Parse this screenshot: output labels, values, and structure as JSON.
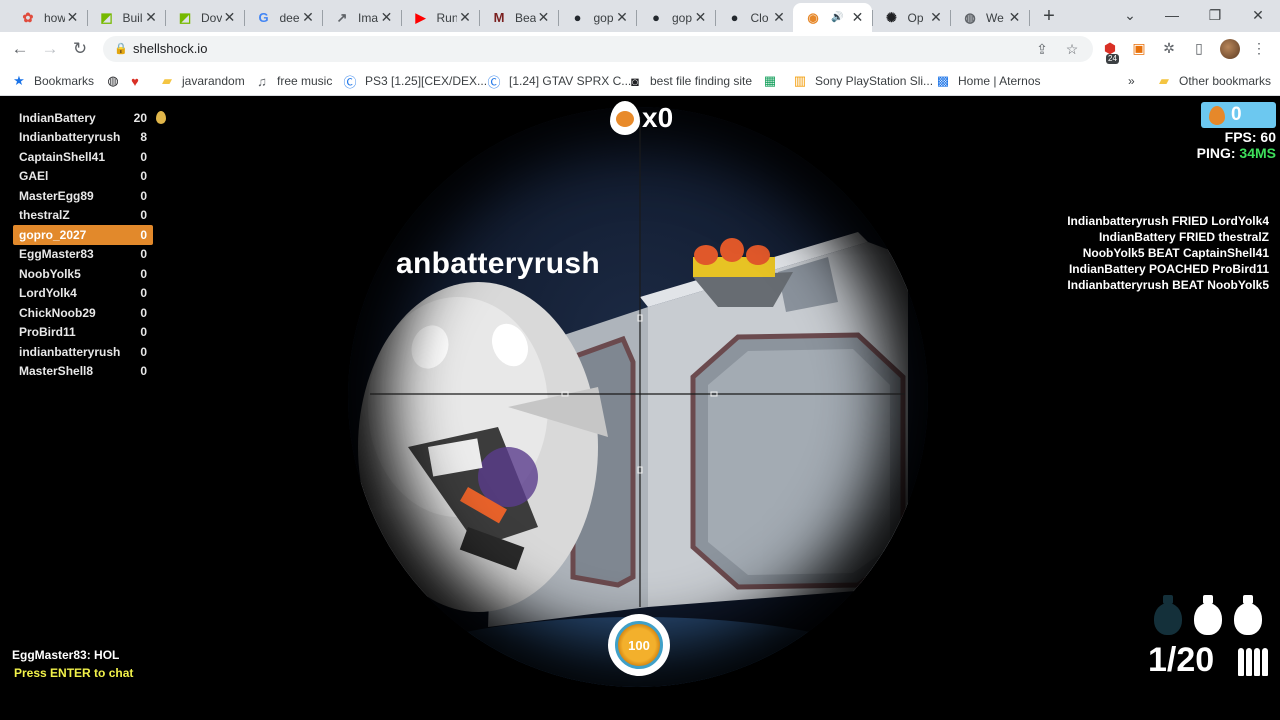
{
  "browser": {
    "tabs": [
      {
        "label": "how",
        "icon": "apps-icon",
        "color": "#e04b3d"
      },
      {
        "label": "Buil",
        "icon": "nvidia-icon",
        "color": "#76b900"
      },
      {
        "label": "Dov",
        "icon": "nvidia-icon",
        "color": "#76b900"
      },
      {
        "label": "dee",
        "icon": "google-icon",
        "color": "#4285f4"
      },
      {
        "label": "Ima",
        "icon": "trend-icon",
        "color": "#5f6368"
      },
      {
        "label": "Run",
        "icon": "youtube-icon",
        "color": "#ff0000"
      },
      {
        "label": "Bea",
        "icon": "m-icon",
        "color": "#7a1f1f"
      },
      {
        "label": "gop",
        "icon": "github-icon",
        "color": "#24292f"
      },
      {
        "label": "gop",
        "icon": "github-icon",
        "color": "#24292f"
      },
      {
        "label": "Clo",
        "icon": "github-icon",
        "color": "#24292f"
      },
      {
        "label": "",
        "icon": "shellshock-icon",
        "color": "#e6882a"
      },
      {
        "label": "Op",
        "icon": "openai-icon",
        "color": "#202124"
      },
      {
        "label": "We",
        "icon": "globe-icon",
        "color": "#5f6368"
      }
    ],
    "url": "shellshock.io",
    "extension_badge": "24"
  },
  "bookmarks": [
    {
      "label": "Bookmarks",
      "icon": "star-icon"
    },
    {
      "label": "",
      "icon": "globe-icon"
    },
    {
      "label": "",
      "icon": "heart-icon"
    },
    {
      "label": "javarandom",
      "icon": "folder-icon"
    },
    {
      "label": "free music",
      "icon": "music-icon"
    },
    {
      "label": "PS3 [1.25][CEX/DEX...",
      "icon": "c-icon"
    },
    {
      "label": "[1.24] GTAV SPRX C...",
      "icon": "c-icon"
    },
    {
      "label": "best file finding site",
      "icon": "robot-icon"
    },
    {
      "label": "",
      "icon": "sheet-icon"
    },
    {
      "label": "Sony PlayStation Sli...",
      "icon": "ps-icon"
    },
    {
      "label": "Home | Aternos",
      "icon": "aternos-icon"
    },
    {
      "label": "Other bookmarks",
      "icon": "folder-icon"
    }
  ],
  "game": {
    "player_name": "anbatteryrush",
    "killstreak": "x0",
    "eggs": "0",
    "fps_label": "FPS:",
    "fps_value": "60",
    "ping_label": "PING:",
    "ping_value": "34MS",
    "leaderboard": [
      {
        "name": "IndianBattery",
        "score": "20"
      },
      {
        "name": "Indianbatteryrush",
        "score": "8"
      },
      {
        "name": "CaptainShell41",
        "score": "0"
      },
      {
        "name": "GAEl",
        "score": "0"
      },
      {
        "name": "MasterEgg89",
        "score": "0"
      },
      {
        "name": "thestralZ",
        "score": "0"
      },
      {
        "name": "gopro_2027",
        "score": "0",
        "me": true
      },
      {
        "name": "EggMaster83",
        "score": "0"
      },
      {
        "name": "NoobYolk5",
        "score": "0"
      },
      {
        "name": "LordYolk4",
        "score": "0"
      },
      {
        "name": "ChickNoob29",
        "score": "0"
      },
      {
        "name": "ProBird11",
        "score": "0"
      },
      {
        "name": "indianbatteryrush",
        "score": "0"
      },
      {
        "name": "MasterShell8",
        "score": "0"
      }
    ],
    "killfeed": [
      "Indianbatteryrush FRIED LordYolk4",
      "IndianBattery FRIED thestralZ",
      "NoobYolk5 BEAT CaptainShell41",
      "IndianBattery POACHED ProBird11",
      "Indianbatteryrush BEAT NoobYolk5"
    ],
    "chat_message": "EggMaster83: HOL",
    "chat_hint": "Press ENTER to chat",
    "health": "100",
    "ammo": "1/20",
    "grenades_available": 2,
    "grenades_total": 3
  }
}
